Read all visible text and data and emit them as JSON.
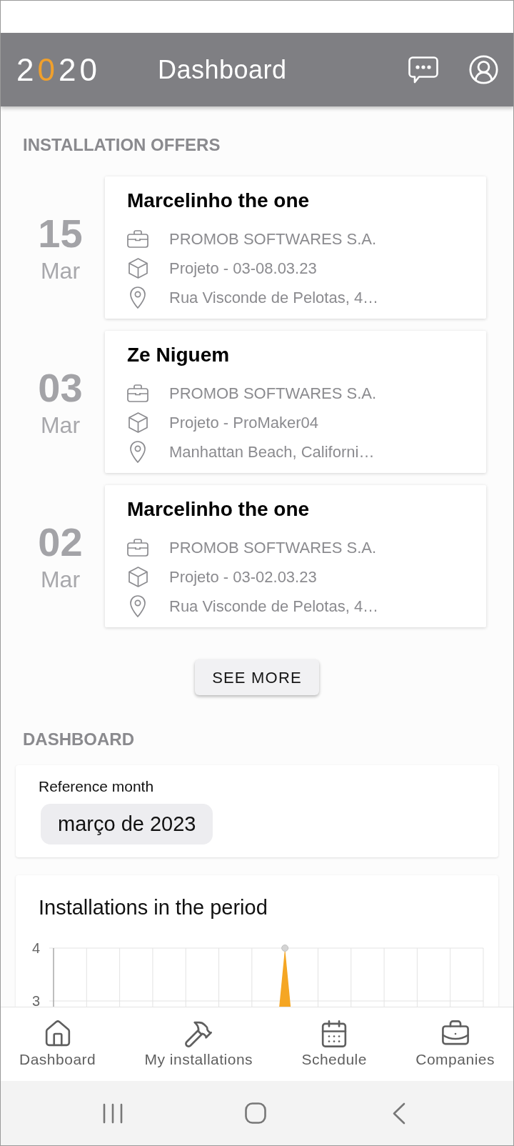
{
  "header": {
    "logo": "2020",
    "title": "Dashboard"
  },
  "installation_offers": {
    "heading": "INSTALLATION OFFERS",
    "offers": [
      {
        "day": "15",
        "month": "Mar",
        "title": "Marcelinho the one",
        "details": [
          {
            "kind": "company",
            "text": "PROMOB SOFTWARES S.A."
          },
          {
            "kind": "project",
            "text": "Projeto - 03-08.03.23"
          },
          {
            "kind": "address",
            "text": "Rua Visconde de Pelotas, 4…"
          }
        ]
      },
      {
        "day": "03",
        "month": "Mar",
        "title": "Ze Niguem",
        "details": [
          {
            "kind": "company",
            "text": "PROMOB SOFTWARES S.A."
          },
          {
            "kind": "project",
            "text": "Projeto - ProMaker04"
          },
          {
            "kind": "address",
            "text": "Manhattan Beach, Californi…"
          }
        ]
      },
      {
        "day": "02",
        "month": "Mar",
        "title": "Marcelinho the one",
        "details": [
          {
            "kind": "company",
            "text": "PROMOB SOFTWARES S.A."
          },
          {
            "kind": "project",
            "text": "Projeto - 03-02.03.23"
          },
          {
            "kind": "address",
            "text": "Rua Visconde de Pelotas, 4…"
          }
        ]
      }
    ],
    "see_more": "SEE MORE"
  },
  "dashboard": {
    "heading": "DASHBOARD",
    "reference_month": {
      "label": "Reference month",
      "value": "março de 2023"
    },
    "installations_chart": {
      "title": "Installations in the period",
      "y_axis_labels": [
        "4",
        "3"
      ]
    }
  },
  "bottom_nav": {
    "items": [
      {
        "label": "Dashboard"
      },
      {
        "label": "My installations"
      },
      {
        "label": "Schedule"
      },
      {
        "label": "Companies"
      }
    ]
  }
}
